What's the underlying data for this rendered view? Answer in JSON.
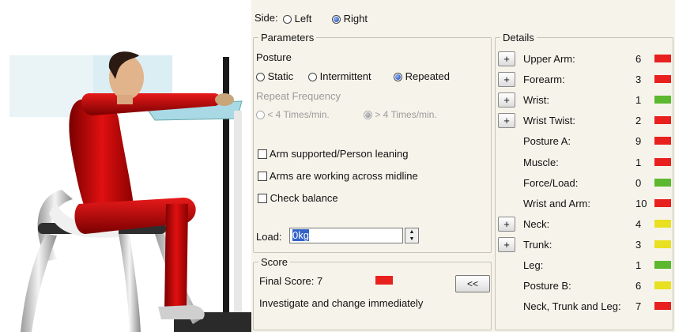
{
  "side": {
    "label": "Side:",
    "options": [
      {
        "label": "Left",
        "selected": false
      },
      {
        "label": "Right",
        "selected": true
      }
    ]
  },
  "parameters": {
    "title": "Parameters",
    "posture_label": "Posture",
    "posture_options": [
      {
        "label": "Static",
        "selected": false
      },
      {
        "label": "Intermittent",
        "selected": false
      },
      {
        "label": "Repeated",
        "selected": true
      }
    ],
    "repeat_frequency_label": "Repeat Frequency",
    "frequency_options": [
      {
        "label": "< 4 Times/min.",
        "selected": false
      },
      {
        "label": "> 4 Times/min.",
        "selected": true
      }
    ],
    "checkboxes": [
      {
        "label": "Arm supported/Person leaning",
        "checked": false
      },
      {
        "label": "Arms are working across midline",
        "checked": false
      },
      {
        "label": "Check balance",
        "checked": false
      }
    ],
    "load_label": "Load:",
    "load_value": "0kg"
  },
  "score": {
    "title": "Score",
    "final_label": "Final Score: 7",
    "final_color": "#e8201e",
    "message": "Investigate and change immediately",
    "collapse_button": "<<"
  },
  "details": {
    "title": "Details",
    "rows": [
      {
        "label": "Upper Arm:",
        "value": "6",
        "color": "#e8201e",
        "expandable": true
      },
      {
        "label": "Forearm:",
        "value": "3",
        "color": "#e8201e",
        "expandable": true
      },
      {
        "label": "Wrist:",
        "value": "1",
        "color": "#5cb82e",
        "expandable": true
      },
      {
        "label": "Wrist Twist:",
        "value": "2",
        "color": "#e8201e",
        "expandable": true
      },
      {
        "label": "Posture A:",
        "value": "9",
        "color": "#e8201e",
        "expandable": false
      },
      {
        "label": "Muscle:",
        "value": "1",
        "color": "#e8201e",
        "expandable": false
      },
      {
        "label": "Force/Load:",
        "value": "0",
        "color": "#5cb82e",
        "expandable": false
      },
      {
        "label": "Wrist and Arm:",
        "value": "10",
        "color": "#e8201e",
        "expandable": false
      },
      {
        "label": "Neck:",
        "value": "4",
        "color": "#e8e020",
        "expandable": true
      },
      {
        "label": "Trunk:",
        "value": "3",
        "color": "#e8e020",
        "expandable": true
      },
      {
        "label": "Leg:",
        "value": "1",
        "color": "#5cb82e",
        "expandable": false
      },
      {
        "label": "Posture B:",
        "value": "6",
        "color": "#e8e020",
        "expandable": false
      },
      {
        "label": "Neck, Trunk and Leg:",
        "value": "7",
        "color": "#e8201e",
        "expandable": false
      }
    ],
    "expand_glyph": "+"
  }
}
